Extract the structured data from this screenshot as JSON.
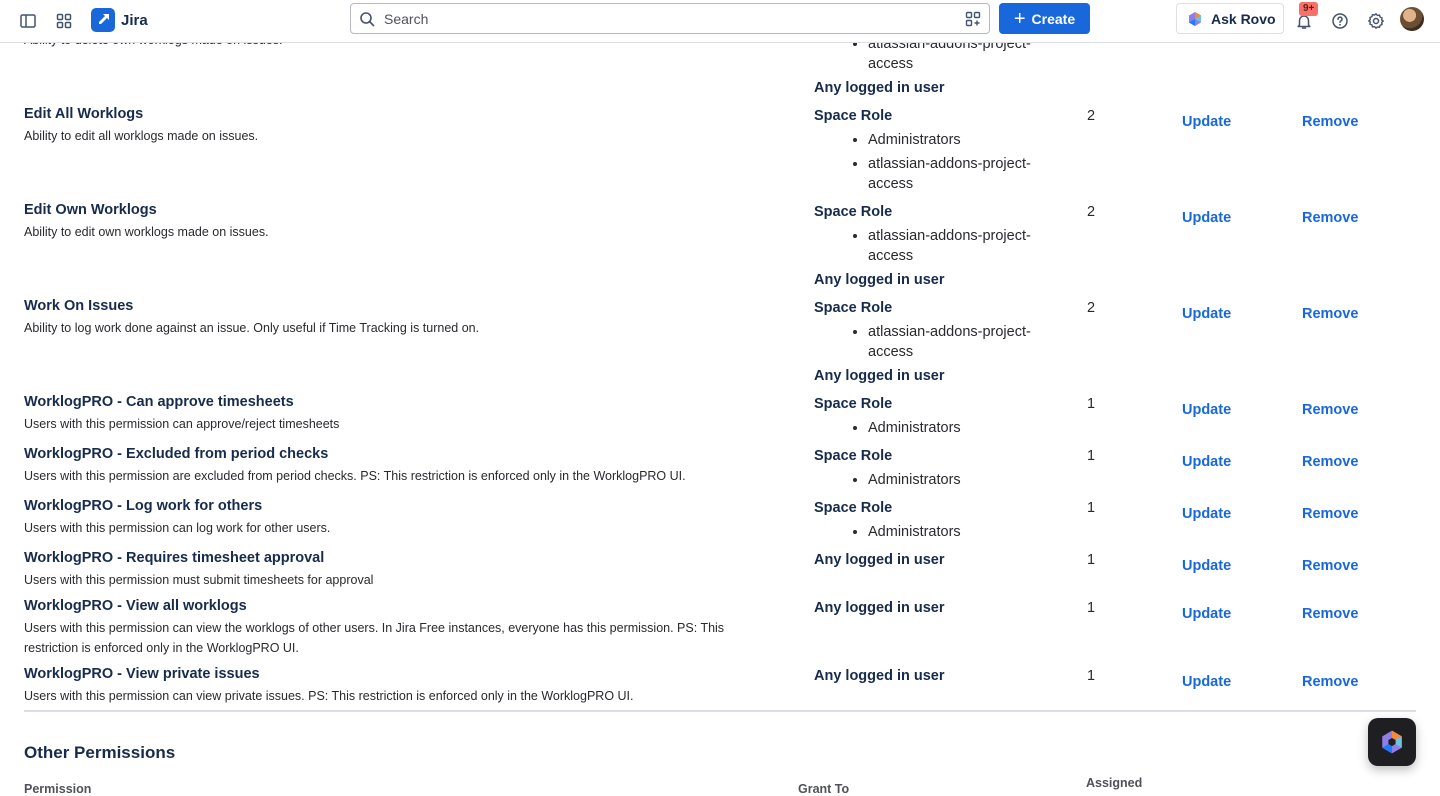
{
  "topbar": {
    "app_name": "Jira",
    "search_placeholder": "Search",
    "create_label": "Create",
    "ask_rovo_label": "Ask Rovo",
    "notification_badge": "9+"
  },
  "partial_top": {
    "description": "Ability to delete own worklogs made on issues.",
    "list": [
      "atlassian-addons-project-access"
    ],
    "tail": "Any logged in user"
  },
  "permissions": [
    {
      "name": "Edit All Worklogs",
      "description": "Ability to edit all worklogs made on issues.",
      "grant_title": "Space Role",
      "grant_list": [
        "Administrators",
        "atlassian-addons-project-access"
      ],
      "grant_tail": "",
      "count": "2",
      "update": "Update",
      "remove": "Remove"
    },
    {
      "name": "Edit Own Worklogs",
      "description": "Ability to edit own worklogs made on issues.",
      "grant_title": "Space Role",
      "grant_list": [
        "atlassian-addons-project-access"
      ],
      "grant_tail": "Any logged in user",
      "count": "2",
      "update": "Update",
      "remove": "Remove"
    },
    {
      "name": "Work On Issues",
      "description": "Ability to log work done against an issue. Only useful if Time Tracking is turned on.",
      "grant_title": "Space Role",
      "grant_list": [
        "atlassian-addons-project-access"
      ],
      "grant_tail": "Any logged in user",
      "count": "2",
      "update": "Update",
      "remove": "Remove"
    },
    {
      "name": "WorklogPRO - Can approve timesheets",
      "description": "Users with this permission can approve/reject timesheets",
      "grant_title": "Space Role",
      "grant_list": [
        "Administrators"
      ],
      "grant_tail": "",
      "count": "1",
      "update": "Update",
      "remove": "Remove"
    },
    {
      "name": "WorklogPRO - Excluded from period checks",
      "description": "Users with this permission are excluded from period checks. PS: This restriction is enforced only in the WorklogPRO UI.",
      "grant_title": "Space Role",
      "grant_list": [
        "Administrators"
      ],
      "grant_tail": "",
      "count": "1",
      "update": "Update",
      "remove": "Remove"
    },
    {
      "name": "WorklogPRO - Log work for others",
      "description": "Users with this permission can log work for other users.",
      "grant_title": "Space Role",
      "grant_list": [
        "Administrators"
      ],
      "grant_tail": "",
      "count": "1",
      "update": "Update",
      "remove": "Remove"
    },
    {
      "name": "WorklogPRO - Requires timesheet approval",
      "description": "Users with this permission must submit timesheets for approval",
      "grant_title": "Any logged in user",
      "grant_list": [],
      "grant_tail": "",
      "count": "1",
      "update": "Update",
      "remove": "Remove"
    },
    {
      "name": "WorklogPRO - View all worklogs",
      "description": "Users with this permission can view the worklogs of other users. In Jira Free instances, everyone has this permission. PS: This restriction is enforced only in the WorklogPRO UI.",
      "grant_title": "Any logged in user",
      "grant_list": [],
      "grant_tail": "",
      "count": "1",
      "update": "Update",
      "remove": "Remove"
    },
    {
      "name": "WorklogPRO - View private issues",
      "description": "Users with this permission can view private issues. PS: This restriction is enforced only in the WorklogPRO UI.",
      "grant_title": "Any logged in user",
      "grant_list": [],
      "grant_tail": "",
      "count": "1",
      "update": "Update",
      "remove": "Remove"
    }
  ],
  "other_section": {
    "title": "Other Permissions",
    "col_permission": "Permission",
    "col_grant_to": "Grant To",
    "col_assigned": "Assigned"
  }
}
